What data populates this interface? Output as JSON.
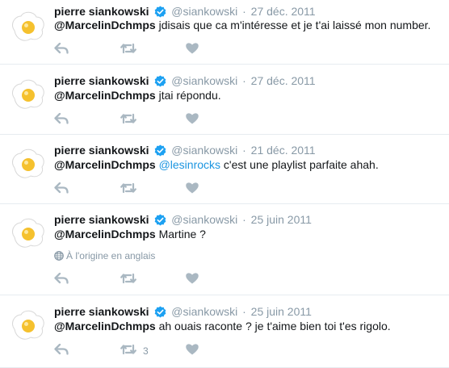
{
  "colors": {
    "name": "#14171a",
    "meta": "#8899a6",
    "link": "#1b95e0",
    "verified": "#1da1f2",
    "icon": "#aab8c2",
    "divider": "#e6ecf0"
  },
  "icons": {
    "avatar": "fried-egg-avatar",
    "verified": "verified-badge-icon",
    "reply": "reply-icon",
    "retweet": "retweet-icon",
    "like": "heart-icon",
    "translate": "globe-icon"
  },
  "tweets": [
    {
      "name": "pierre siankowski",
      "handle": "@siankowski",
      "sep": "·",
      "time": "27 déc. 2011",
      "mention": "@MarcelinDchmps",
      "text": " jdisais que ca m'intéresse et je t'ai laissé mon number."
    },
    {
      "name": "pierre siankowski",
      "handle": "@siankowski",
      "sep": "·",
      "time": "27 déc. 2011",
      "mention": "@MarcelinDchmps",
      "text": " jtai répondu."
    },
    {
      "name": "pierre siankowski",
      "handle": "@siankowski",
      "sep": "·",
      "time": "21 déc. 2011",
      "mention": "@MarcelinDchmps",
      "link": "@lesinrocks",
      "text": " c'est une playlist parfaite ahah."
    },
    {
      "name": "pierre siankowski",
      "handle": "@siankowski",
      "sep": "·",
      "time": "25 juin 2011",
      "mention": "@MarcelinDchmps",
      "text": " Martine ?",
      "translate": "À l'origine en anglais"
    },
    {
      "name": "pierre siankowski",
      "handle": "@siankowski",
      "sep": "·",
      "time": "25 juin 2011",
      "mention": "@MarcelinDchmps",
      "text": " ah ouais raconte ? je t'aime bien toi t'es rigolo.",
      "retweet_count": "3"
    }
  ]
}
